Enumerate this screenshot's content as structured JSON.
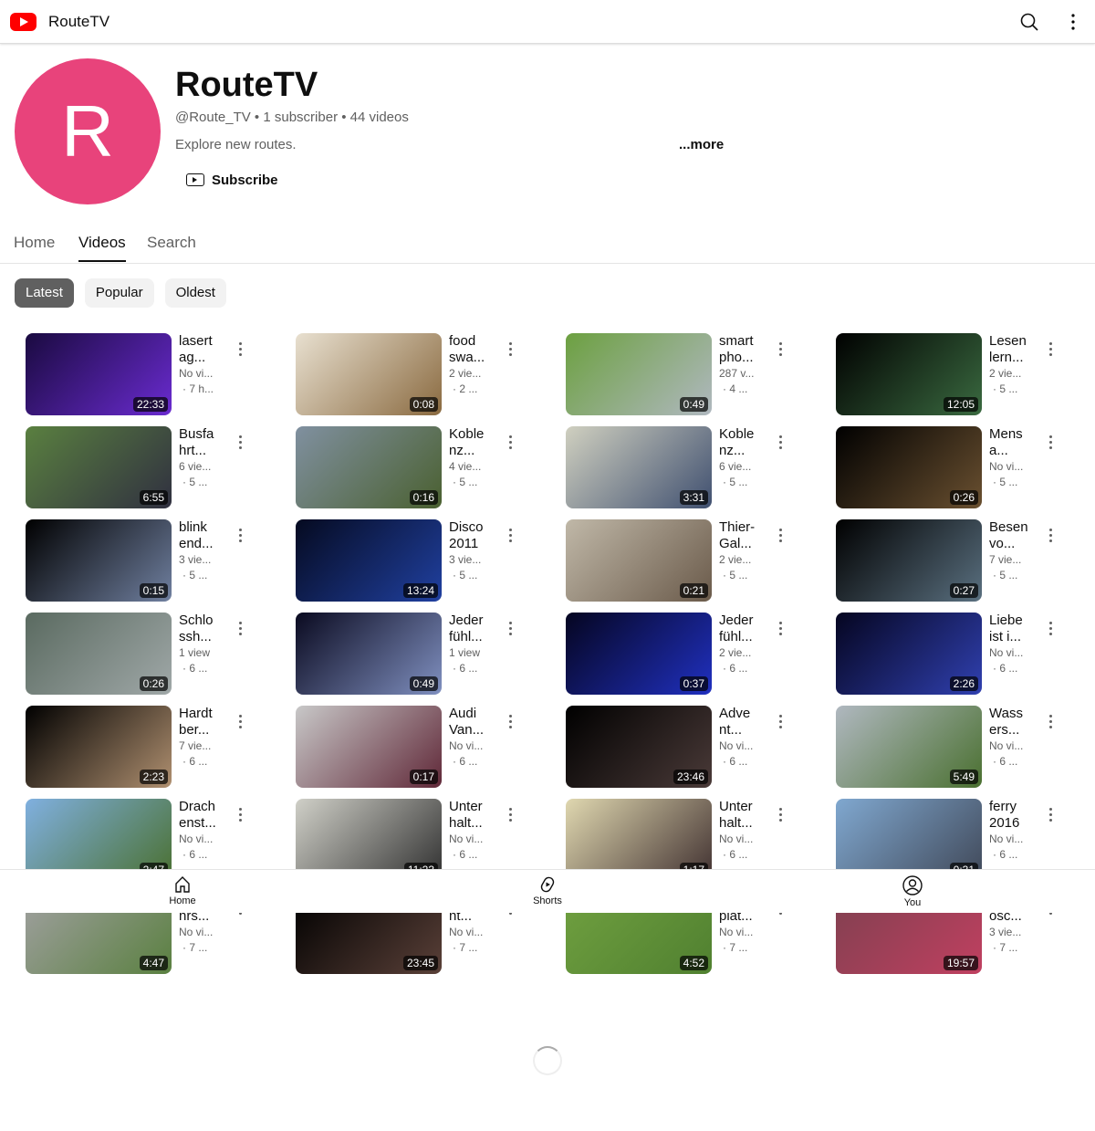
{
  "app": {
    "title": "RouteTV",
    "brand_color": "#ff0000"
  },
  "channel": {
    "avatar_letter": "R",
    "avatar_color": "#e8437b",
    "name": "RouteTV",
    "handle": "@Route_TV",
    "subscribers": "1 subscriber",
    "videos": "44 videos",
    "description": "Explore new routes.",
    "more": "...more",
    "subscribe": "Subscribe"
  },
  "tabs": [
    {
      "label": "Home"
    },
    {
      "label": "Videos",
      "active": true
    },
    {
      "label": "Search"
    }
  ],
  "chips": [
    {
      "label": "Latest",
      "active": true
    },
    {
      "label": "Popular"
    },
    {
      "label": "Oldest"
    }
  ],
  "videos": [
    {
      "l1": "lasert",
      "l2": "ag...",
      "views": "No vi...",
      "age": "· 7 h...",
      "duration": "22:33",
      "c": [
        "#1a0a40",
        "#6a2bd0"
      ]
    },
    {
      "l1": "food",
      "l2": "swa...",
      "views": "2 vie...",
      "age": "· 2 ...",
      "duration": "0:08",
      "c": [
        "#e8e0d0",
        "#8a6a40"
      ]
    },
    {
      "l1": "smart",
      "l2": "pho...",
      "views": "287 v...",
      "age": "· 4 ...",
      "duration": "0:49",
      "c": [
        "#6ca040",
        "#b0b8c0"
      ]
    },
    {
      "l1": "Lesen",
      "l2": "lern...",
      "views": "2 vie...",
      "age": "· 5 ...",
      "duration": "12:05",
      "c": [
        "#000",
        "#3a6a40"
      ]
    },
    {
      "l1": "Busfa",
      "l2": "hrt...",
      "views": "6 vie...",
      "age": "· 5 ...",
      "duration": "6:55",
      "c": [
        "#5a8040",
        "#303040"
      ]
    },
    {
      "l1": "Koble",
      "l2": "nz...",
      "views": "4 vie...",
      "age": "· 5 ...",
      "duration": "0:16",
      "c": [
        "#8090a0",
        "#4a6030"
      ]
    },
    {
      "l1": "Koble",
      "l2": "nz...",
      "views": "6 vie...",
      "age": "· 5 ...",
      "duration": "3:31",
      "c": [
        "#d0d0c0",
        "#405070"
      ]
    },
    {
      "l1": "Mens",
      "l2": "a...",
      "views": "No vi...",
      "age": "· 5 ...",
      "duration": "0:26",
      "c": [
        "#000",
        "#6a5030"
      ]
    },
    {
      "l1": "blink",
      "l2": "end...",
      "views": "3 vie...",
      "age": "· 5 ...",
      "duration": "0:15",
      "c": [
        "#000",
        "#7080a0"
      ]
    },
    {
      "l1": "Disco",
      "l2": "2011",
      "views": "3 vie...",
      "age": "· 5 ...",
      "duration": "13:24",
      "c": [
        "#050a20",
        "#2040a0"
      ]
    },
    {
      "l1": "Thier-",
      "l2": "Gal...",
      "views": "2 vie...",
      "age": "· 5 ...",
      "duration": "0:21",
      "c": [
        "#c0b8a8",
        "#6a5a4a"
      ]
    },
    {
      "l1": "Besen",
      "l2": "vo...",
      "views": "7 vie...",
      "age": "· 5 ...",
      "duration": "0:27",
      "c": [
        "#000",
        "#5a7080"
      ]
    },
    {
      "l1": "Schlo",
      "l2": "ssh...",
      "views": "1 view",
      "age": "· 6 ...",
      "duration": "0:26",
      "c": [
        "#5a6a60",
        "#a0a8a8"
      ]
    },
    {
      "l1": "Jeder",
      "l2": "fühl...",
      "views": "1 view",
      "age": "· 6 ...",
      "duration": "0:49",
      "c": [
        "#0a0a20",
        "#8090c0"
      ]
    },
    {
      "l1": "Jeder",
      "l2": "fühl...",
      "views": "2 vie...",
      "age": "· 6 ...",
      "duration": "0:37",
      "c": [
        "#050520",
        "#2030c0"
      ]
    },
    {
      "l1": "Liebe",
      "l2": "ist i...",
      "views": "No vi...",
      "age": "· 6 ...",
      "duration": "2:26",
      "c": [
        "#050520",
        "#3040b0"
      ]
    },
    {
      "l1": "Hardt",
      "l2": "ber...",
      "views": "7 vie...",
      "age": "· 6 ...",
      "duration": "2:23",
      "c": [
        "#000",
        "#b09070"
      ]
    },
    {
      "l1": "Audi",
      "l2": "Van...",
      "views": "No vi...",
      "age": "· 6 ...",
      "duration": "0:17",
      "c": [
        "#c8c8c8",
        "#602838"
      ]
    },
    {
      "l1": "Adve",
      "l2": "nt...",
      "views": "No vi...",
      "age": "· 6 ...",
      "duration": "23:46",
      "c": [
        "#000",
        "#4a3a38"
      ]
    },
    {
      "l1": "Wass",
      "l2": "ers...",
      "views": "No vi...",
      "age": "· 6 ...",
      "duration": "5:49",
      "c": [
        "#b0b8c0",
        "#4a7030"
      ]
    },
    {
      "l1": "Drach",
      "l2": "enst...",
      "views": "No vi...",
      "age": "· 6 ...",
      "duration": "2:47",
      "c": [
        "#80b0e0",
        "#4a7030"
      ]
    },
    {
      "l1": "Unter",
      "l2": "halt...",
      "views": "No vi...",
      "age": "· 6 ...",
      "duration": "11:23",
      "c": [
        "#d0d0c8",
        "#303030"
      ]
    },
    {
      "l1": "Unter",
      "l2": "halt...",
      "views": "No vi...",
      "age": "· 6 ...",
      "duration": "1:17",
      "c": [
        "#e0d8b0",
        "#403030"
      ]
    },
    {
      "l1": "ferry",
      "l2": "2016",
      "views": "No vi...",
      "age": "· 6 ...",
      "duration": "0:31",
      "c": [
        "#80a8d0",
        "#404858"
      ]
    },
    {
      "l1": "",
      "l2": "hrs...",
      "views": "No vi...",
      "age": "· 7 ...",
      "duration": "4:47",
      "c": [
        "#a0a0a0",
        "#5a8040"
      ]
    },
    {
      "l1": "",
      "l2": "nt...",
      "views": "No vi...",
      "age": "· 7 ...",
      "duration": "23:45",
      "c": [
        "#000",
        "#5a4038"
      ]
    },
    {
      "l1": "",
      "l2": "plat...",
      "views": "No vi...",
      "age": "· 7 ...",
      "duration": "4:52",
      "c": [
        "#70a040",
        "#508030"
      ]
    },
    {
      "l1": "",
      "l2": "osc...",
      "views": "3 vie...",
      "age": "· 7 ...",
      "duration": "19:57",
      "c": [
        "#804050",
        "#c04060"
      ]
    }
  ],
  "bottom_nav": [
    {
      "label": "Home",
      "icon": "home-icon"
    },
    {
      "label": "Shorts",
      "icon": "shorts-icon"
    },
    {
      "label": "You",
      "icon": "account-icon"
    }
  ]
}
